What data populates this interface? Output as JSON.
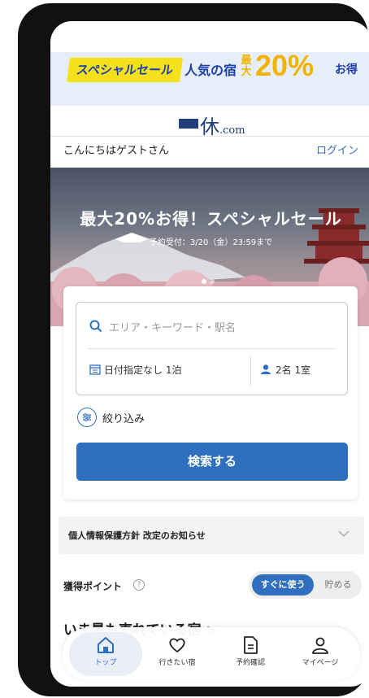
{
  "banner": {
    "sale_tag": "スペシャルセール",
    "text": "人気の宿",
    "max_label": "最大",
    "percent": "20%",
    "deal": "お得"
  },
  "logo": {
    "kanji": "休",
    "suffix": ".com"
  },
  "header": {
    "greeting": "こんにちはゲストさん",
    "login": "ログイン"
  },
  "hero": {
    "title": "最大20%お得！スペシャルセール",
    "subtitle": "予約受付：3/20（金）23:59まで",
    "slide_count": 2,
    "active_slide": 1
  },
  "search": {
    "placeholder": "エリア・キーワード・駅名",
    "date": "日付指定なし 1泊",
    "guests": "2名 1室",
    "filter_label": "絞り込み",
    "submit_label": "検索する"
  },
  "notice": {
    "text": "個人情報保護方針 改定のお知らせ"
  },
  "points": {
    "label": "獲得ポイント",
    "toggle_use": "すぐに使う",
    "toggle_save": "貯める"
  },
  "section": {
    "popular_title": "いま最も売れている宿"
  },
  "tabbar": {
    "items": [
      {
        "label": "トップ",
        "icon": "home-icon",
        "active": true
      },
      {
        "label": "行きたい宿",
        "icon": "heart-icon",
        "active": false
      },
      {
        "label": "予約確認",
        "icon": "document-icon",
        "active": false
      },
      {
        "label": "マイページ",
        "icon": "user-icon",
        "active": false
      }
    ]
  },
  "colors": {
    "brand_blue": "#2e6fbf",
    "sale_yellow": "#f5e11a",
    "percent_gold": "#f0b400",
    "banner_bg": "#e6eefa",
    "logo_navy": "#1f3f7a"
  }
}
